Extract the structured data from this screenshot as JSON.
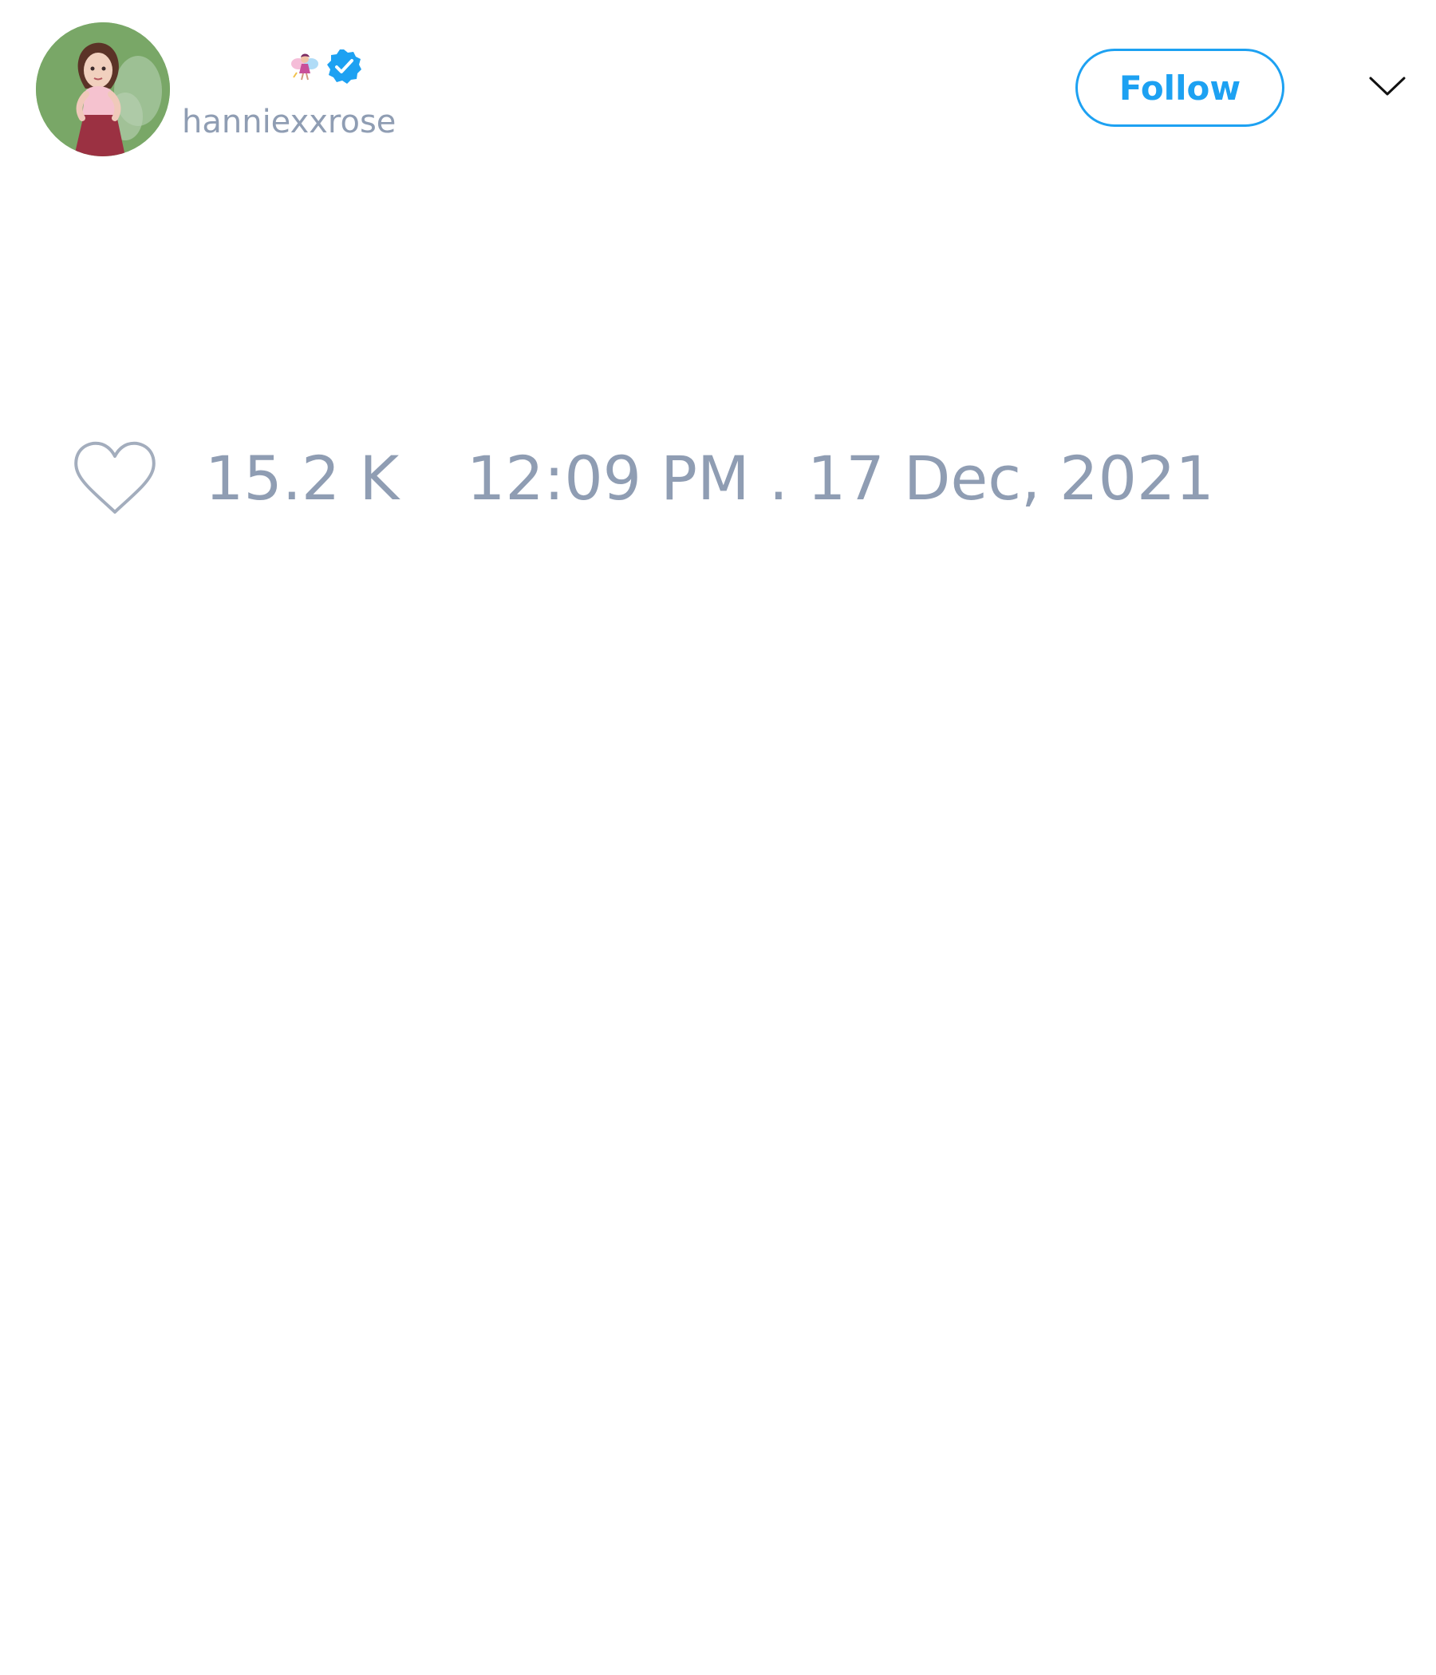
{
  "user": {
    "display_name": "",
    "name_emoji_icon": "fairy-icon",
    "verified_icon": "verified-badge-icon",
    "handle": "hanniexxrose",
    "avatar_icon": "profile-avatar"
  },
  "actions": {
    "follow_label": "Follow",
    "menu_icon": "chevron-down-icon"
  },
  "stats": {
    "like_icon": "heart-icon",
    "like_count": "15.2 K",
    "timestamp": "12:09 PM . 17 Dec, 2021"
  },
  "colors": {
    "accent": "#1da1f2",
    "muted_text": "#8f9db3",
    "background": "#ffffff"
  }
}
